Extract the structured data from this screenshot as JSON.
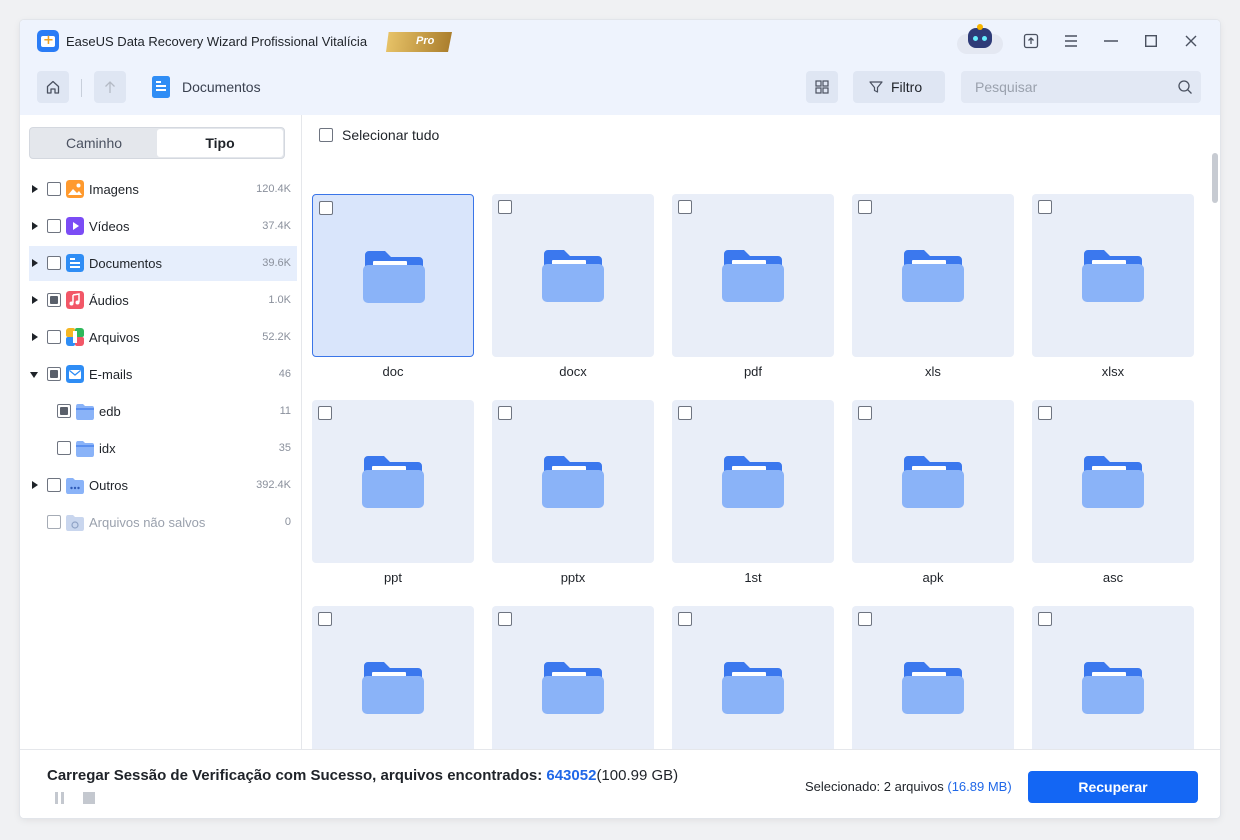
{
  "app": {
    "title": "EaseUS Data Recovery Wizard Profissional Vitalícia",
    "badge": "Pro",
    "accent": "#1366f4"
  },
  "nav": {
    "breadcrumb": "Documentos",
    "filter_label": "Filtro",
    "search_placeholder": "Pesquisar"
  },
  "sidebar": {
    "tabs": [
      "Caminho",
      "Tipo"
    ],
    "active_tab": "Tipo",
    "items": [
      {
        "label": "Imagens",
        "count": "120.4K",
        "icon": "images-icon",
        "state": "unchecked",
        "expanded": false
      },
      {
        "label": "Vídeos",
        "count": "37.4K",
        "icon": "videos-icon",
        "state": "unchecked",
        "expanded": false
      },
      {
        "label": "Documentos",
        "count": "39.6K",
        "icon": "documents-icon",
        "state": "unchecked",
        "expanded": false,
        "selected": true
      },
      {
        "label": "Áudios",
        "count": "1.0K",
        "icon": "audio-icon",
        "state": "partial",
        "expanded": false
      },
      {
        "label": "Arquivos",
        "count": "52.2K",
        "icon": "archives-icon",
        "state": "unchecked",
        "expanded": false
      },
      {
        "label": "E-mails",
        "count": "46",
        "icon": "email-icon",
        "state": "partial",
        "expanded": true
      },
      {
        "label": "edb",
        "count": "11",
        "icon": "folder-icon",
        "state": "partial",
        "child": true
      },
      {
        "label": "idx",
        "count": "35",
        "icon": "folder-icon",
        "state": "unchecked",
        "child": true
      },
      {
        "label": "Outros",
        "count": "392.4K",
        "icon": "others-icon",
        "state": "unchecked",
        "expanded": false
      },
      {
        "label": "Arquivos não salvos",
        "count": "0",
        "icon": "unsaved-icon",
        "state": "unchecked",
        "muted": true
      }
    ]
  },
  "content": {
    "select_all": "Selecionar tudo",
    "folders": [
      "doc",
      "docx",
      "pdf",
      "xls",
      "xlsx",
      "ppt",
      "pptx",
      "1st",
      "apk",
      "asc",
      "",
      "",
      "",
      "",
      ""
    ]
  },
  "footer": {
    "status_prefix": "Carregar Sessão de Verificação com Sucesso, arquivos encontrados: ",
    "files_found": "643052",
    "total_size": "(100.99 GB)",
    "selected_prefix": "Selecionado: 2 arquivos ",
    "selected_size": "(16.89 MB)",
    "recover_label": "Recuperar"
  }
}
